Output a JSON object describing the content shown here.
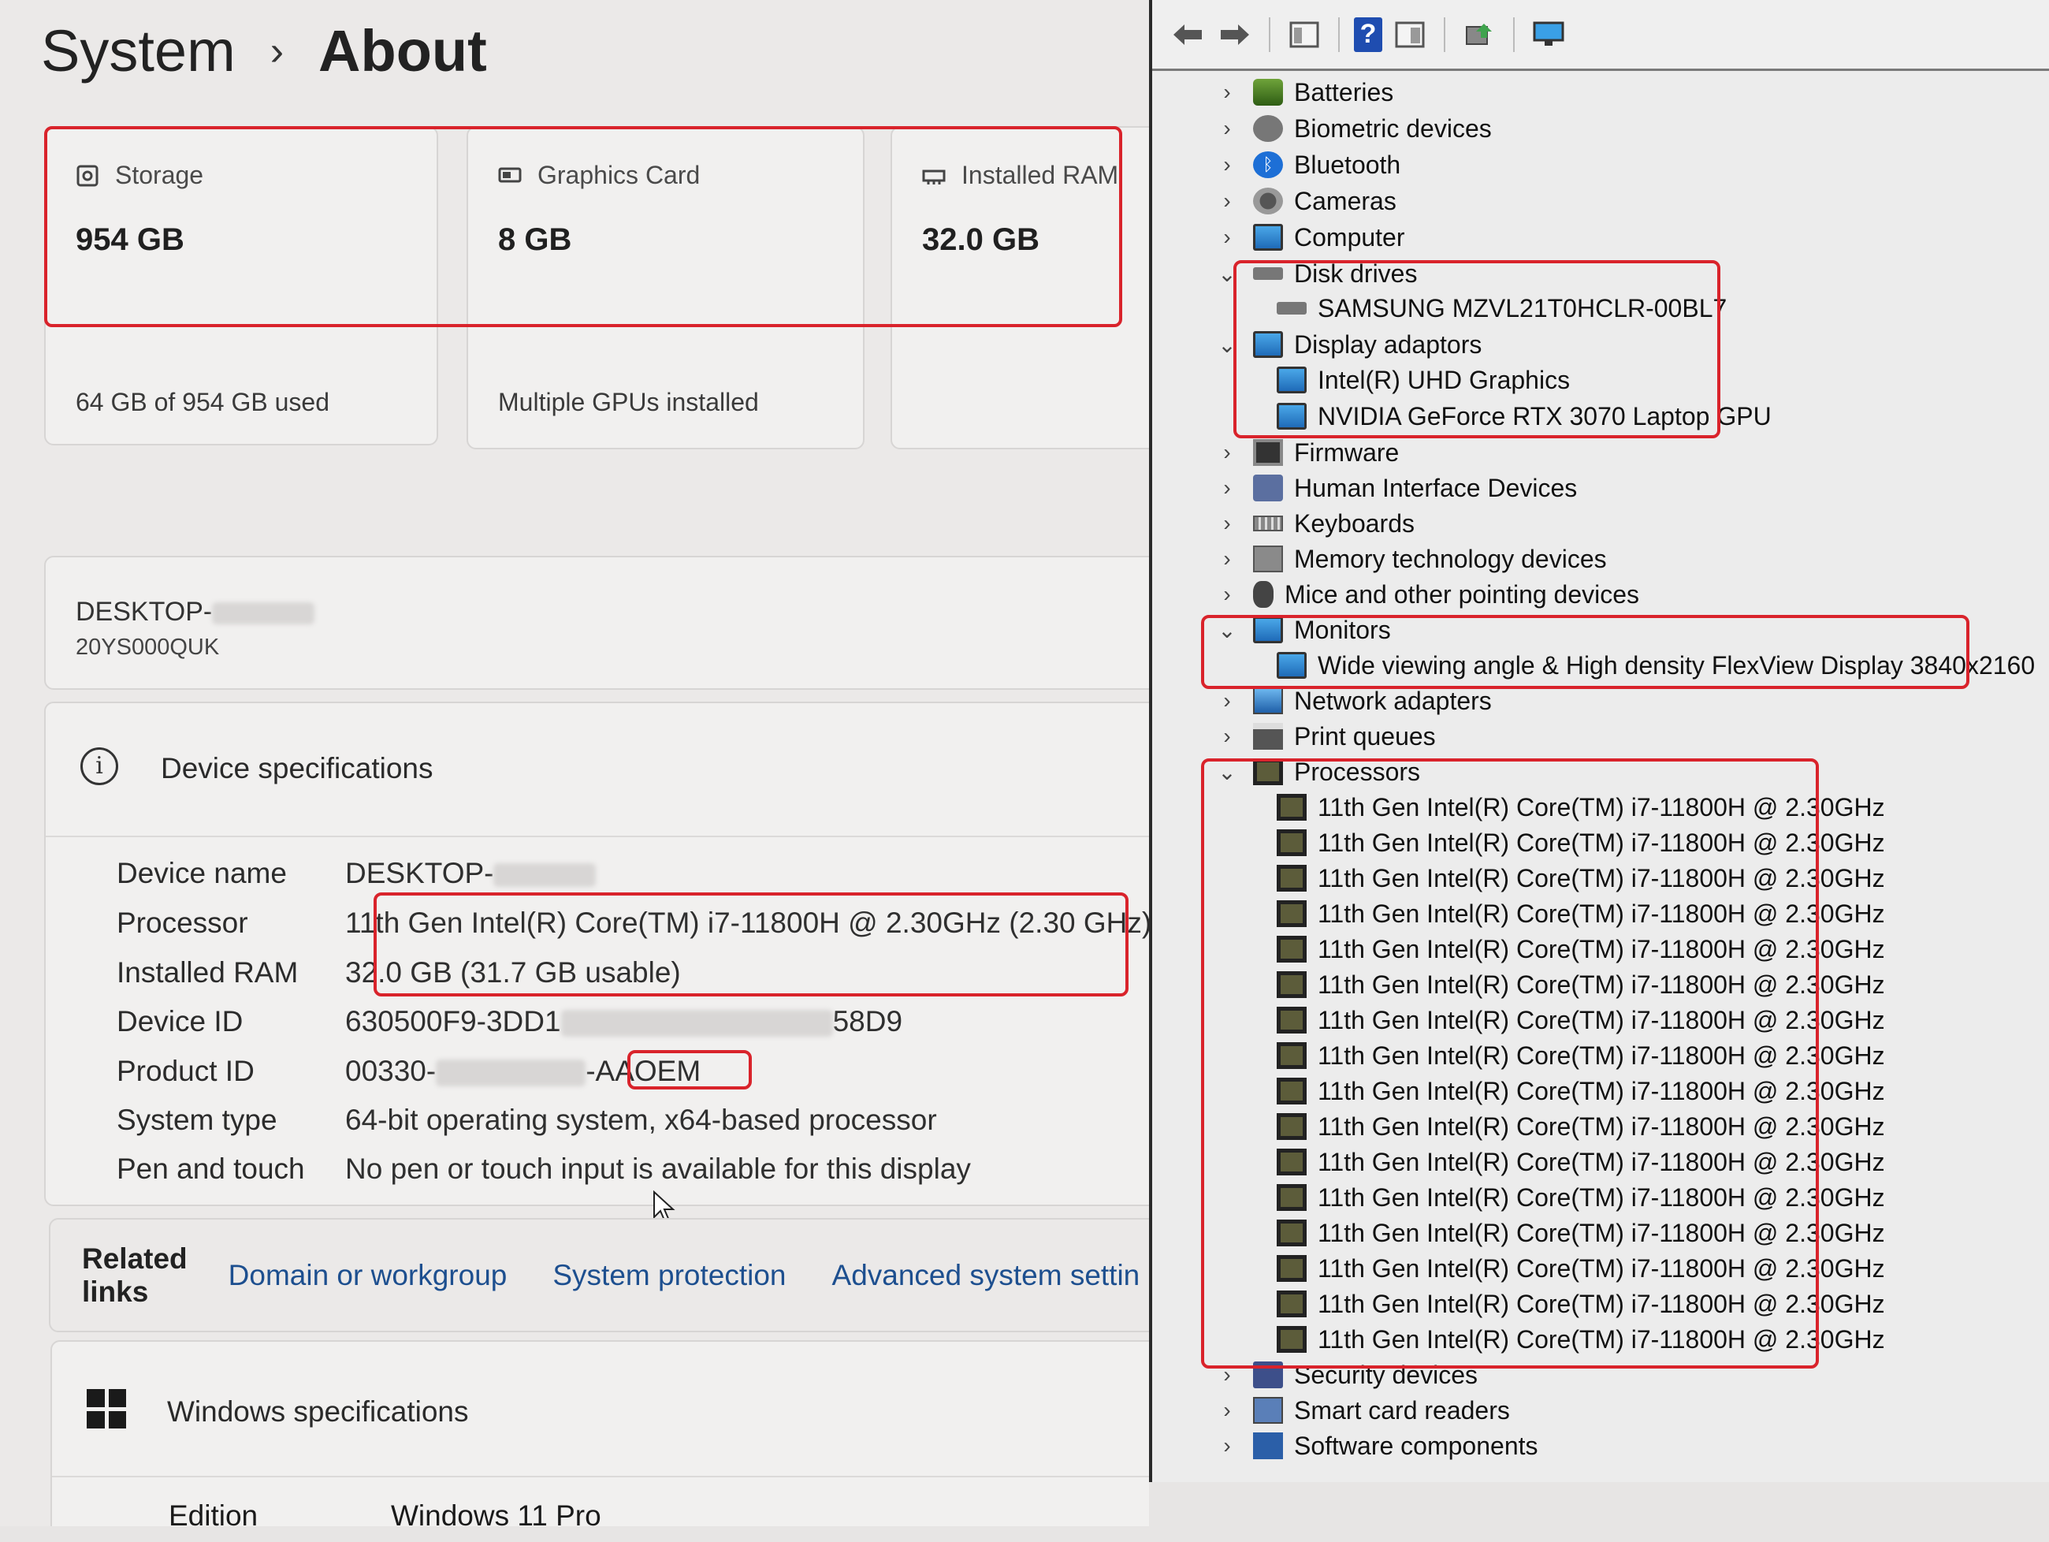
{
  "settings": {
    "breadcrumb": {
      "parent": "System",
      "separator": "›",
      "current": "About"
    },
    "cards": [
      {
        "caption": "Storage",
        "icon": "storage-icon",
        "value": "954 GB",
        "sub": "64 GB of 954 GB used"
      },
      {
        "caption": "Graphics Card",
        "icon": "graphics-card-icon",
        "value": "8 GB",
        "sub": "Multiple GPUs installed"
      },
      {
        "caption": "Installed RAM",
        "icon": "ram-icon",
        "value": "32.0 GB",
        "sub": ""
      }
    ],
    "device_card": {
      "name_prefix": "DESKTOP-",
      "model": "20YS000QUK"
    },
    "device_specs": {
      "title": "Device specifications",
      "rows": [
        {
          "key": "Device name",
          "value": "DESKTOP-"
        },
        {
          "key": "Processor",
          "value": "11th Gen Intel(R) Core(TM) i7-11800H @ 2.30GHz (2.30 GHz)"
        },
        {
          "key": "Installed RAM",
          "value": "32.0 GB (31.7 GB usable)"
        },
        {
          "key": "Device ID",
          "value_start": "630500F9-3DD1",
          "value_end": "58D9"
        },
        {
          "key": "Product ID",
          "value_start": "00330-",
          "value_end": "-AAOEM"
        },
        {
          "key": "System type",
          "value": "64-bit operating system, x64-based processor"
        },
        {
          "key": "Pen and touch",
          "value": "No pen or touch input is available for this display"
        }
      ]
    },
    "related_links": {
      "label": "Related links",
      "links": [
        "Domain or workgroup",
        "System protection",
        "Advanced system settin"
      ]
    },
    "windows_specs": {
      "title": "Windows specifications",
      "edition_key": "Edition",
      "edition_value": "Windows 11 Pro"
    }
  },
  "device_manager": {
    "toolbar": [
      "back-arrow-icon",
      "forward-arrow-icon",
      "properties-icon",
      "help-icon",
      "view-icon",
      "update-driver-icon",
      "monitor-icon"
    ],
    "help_glyph": "?",
    "tree": [
      {
        "label": "Batteries",
        "expanded": false,
        "icon": "battery-icon"
      },
      {
        "label": "Biometric devices",
        "expanded": false,
        "icon": "biometric-icon"
      },
      {
        "label": "Bluetooth",
        "expanded": false,
        "icon": "bluetooth-icon"
      },
      {
        "label": "Cameras",
        "expanded": false,
        "icon": "camera-icon"
      },
      {
        "label": "Computer",
        "expanded": false,
        "icon": "computer-icon"
      },
      {
        "label": "Disk drives",
        "expanded": true,
        "icon": "disk-drive-icon",
        "children": [
          "SAMSUNG MZVL21T0HCLR-00BL7"
        ]
      },
      {
        "label": "Display adaptors",
        "expanded": true,
        "icon": "display-adapter-icon",
        "children": [
          "Intel(R) UHD Graphics",
          "NVIDIA GeForce RTX 3070 Laptop GPU"
        ]
      },
      {
        "label": "Firmware",
        "expanded": false,
        "icon": "firmware-icon"
      },
      {
        "label": "Human Interface Devices",
        "expanded": false,
        "icon": "hid-icon"
      },
      {
        "label": "Keyboards",
        "expanded": false,
        "icon": "keyboard-icon"
      },
      {
        "label": "Memory technology devices",
        "expanded": false,
        "icon": "memory-icon"
      },
      {
        "label": "Mice and other pointing devices",
        "expanded": false,
        "icon": "mouse-icon"
      },
      {
        "label": "Monitors",
        "expanded": true,
        "icon": "monitor-icon",
        "children": [
          "Wide viewing angle & High density FlexView Display 3840x2160"
        ]
      },
      {
        "label": "Network adapters",
        "expanded": false,
        "icon": "network-icon"
      },
      {
        "label": "Print queues",
        "expanded": false,
        "icon": "printer-icon"
      },
      {
        "label": "Processors",
        "expanded": true,
        "icon": "processor-icon",
        "children": [
          "11th Gen Intel(R) Core(TM) i7-11800H @ 2.30GHz",
          "11th Gen Intel(R) Core(TM) i7-11800H @ 2.30GHz",
          "11th Gen Intel(R) Core(TM) i7-11800H @ 2.30GHz",
          "11th Gen Intel(R) Core(TM) i7-11800H @ 2.30GHz",
          "11th Gen Intel(R) Core(TM) i7-11800H @ 2.30GHz",
          "11th Gen Intel(R) Core(TM) i7-11800H @ 2.30GHz",
          "11th Gen Intel(R) Core(TM) i7-11800H @ 2.30GHz",
          "11th Gen Intel(R) Core(TM) i7-11800H @ 2.30GHz",
          "11th Gen Intel(R) Core(TM) i7-11800H @ 2.30GHz",
          "11th Gen Intel(R) Core(TM) i7-11800H @ 2.30GHz",
          "11th Gen Intel(R) Core(TM) i7-11800H @ 2.30GHz",
          "11th Gen Intel(R) Core(TM) i7-11800H @ 2.30GHz",
          "11th Gen Intel(R) Core(TM) i7-11800H @ 2.30GHz",
          "11th Gen Intel(R) Core(TM) i7-11800H @ 2.30GHz",
          "11th Gen Intel(R) Core(TM) i7-11800H @ 2.30GHz",
          "11th Gen Intel(R) Core(TM) i7-11800H @ 2.30GHz"
        ]
      },
      {
        "label": "Security devices",
        "expanded": false,
        "icon": "security-icon"
      },
      {
        "label": "Smart card readers",
        "expanded": false,
        "icon": "smart-card-icon"
      },
      {
        "label": "Software components",
        "expanded": false,
        "icon": "software-component-icon"
      }
    ]
  },
  "colors": {
    "highlight_border": "#d9232b",
    "link": "#1d4f8f"
  }
}
